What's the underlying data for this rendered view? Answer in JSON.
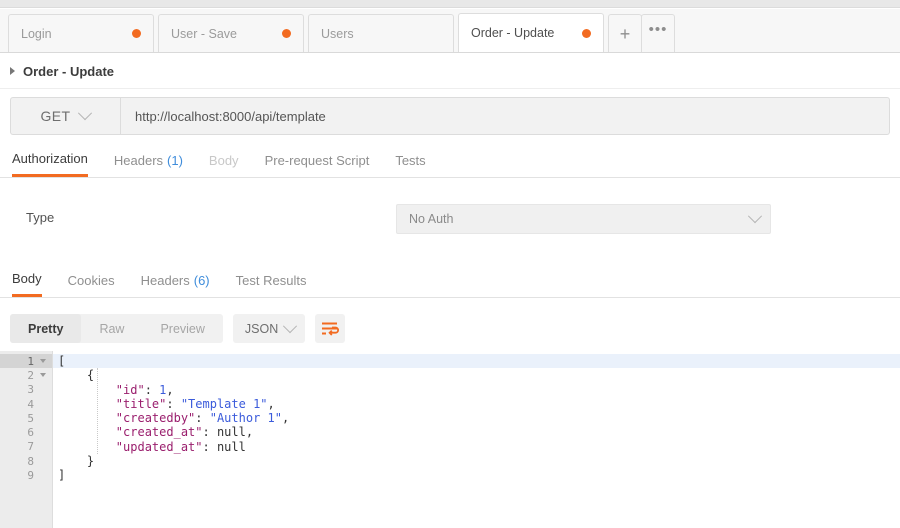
{
  "window": {
    "tabs": [
      {
        "label": "Login",
        "unsaved": true,
        "active": false
      },
      {
        "label": "User - Save",
        "unsaved": true,
        "active": false
      },
      {
        "label": "Users",
        "unsaved": false,
        "active": false
      },
      {
        "label": "Order - Update",
        "unsaved": true,
        "active": true
      }
    ],
    "new_tab_label": "+",
    "more_tabs_label": "•••"
  },
  "request": {
    "name": "Order - Update",
    "method": "GET",
    "url": "http://localhost:8000/api/template",
    "tabs": [
      {
        "label": "Authorization",
        "count": "",
        "state": "active"
      },
      {
        "label": "Headers",
        "count": "(1)",
        "state": "normal"
      },
      {
        "label": "Body",
        "count": "",
        "state": "disabled"
      },
      {
        "label": "Pre-request Script",
        "count": "",
        "state": "normal"
      },
      {
        "label": "Tests",
        "count": "",
        "state": "normal"
      }
    ]
  },
  "authorization": {
    "type_label": "Type",
    "selected_type": "No Auth"
  },
  "response": {
    "tabs": [
      {
        "label": "Body",
        "count": "",
        "state": "active"
      },
      {
        "label": "Cookies",
        "count": "",
        "state": "normal"
      },
      {
        "label": "Headers",
        "count": "(6)",
        "state": "normal"
      },
      {
        "label": "Test Results",
        "count": "",
        "state": "normal"
      }
    ],
    "view_modes": [
      {
        "label": "Pretty",
        "active": true
      },
      {
        "label": "Raw",
        "active": false
      },
      {
        "label": "Preview",
        "active": false
      }
    ],
    "format": "JSON",
    "wrap_icon": "word-wrap-icon",
    "accent_color": "#f26b21",
    "body_lines": [
      {
        "n": "1",
        "fold": true,
        "current": true,
        "indent": 0,
        "tokens": [
          {
            "t": "brace",
            "v": "["
          }
        ]
      },
      {
        "n": "2",
        "fold": true,
        "current": false,
        "indent": 1,
        "tokens": [
          {
            "t": "brace",
            "v": "{"
          }
        ]
      },
      {
        "n": "3",
        "fold": false,
        "current": false,
        "indent": 2,
        "tokens": [
          {
            "t": "key",
            "v": "\"id\""
          },
          {
            "t": "punc",
            "v": ": "
          },
          {
            "t": "num",
            "v": "1"
          },
          {
            "t": "punc",
            "v": ","
          }
        ]
      },
      {
        "n": "4",
        "fold": false,
        "current": false,
        "indent": 2,
        "tokens": [
          {
            "t": "key",
            "v": "\"title\""
          },
          {
            "t": "punc",
            "v": ": "
          },
          {
            "t": "str",
            "v": "\"Template 1\""
          },
          {
            "t": "punc",
            "v": ","
          }
        ]
      },
      {
        "n": "5",
        "fold": false,
        "current": false,
        "indent": 2,
        "tokens": [
          {
            "t": "key",
            "v": "\"createdby\""
          },
          {
            "t": "punc",
            "v": ": "
          },
          {
            "t": "str",
            "v": "\"Author 1\""
          },
          {
            "t": "punc",
            "v": ","
          }
        ]
      },
      {
        "n": "6",
        "fold": false,
        "current": false,
        "indent": 2,
        "tokens": [
          {
            "t": "key",
            "v": "\"created_at\""
          },
          {
            "t": "punc",
            "v": ": "
          },
          {
            "t": "null",
            "v": "null"
          },
          {
            "t": "punc",
            "v": ","
          }
        ]
      },
      {
        "n": "7",
        "fold": false,
        "current": false,
        "indent": 2,
        "tokens": [
          {
            "t": "key",
            "v": "\"updated_at\""
          },
          {
            "t": "punc",
            "v": ": "
          },
          {
            "t": "null",
            "v": "null"
          }
        ]
      },
      {
        "n": "8",
        "fold": false,
        "current": false,
        "indent": 1,
        "tokens": [
          {
            "t": "brace",
            "v": "}"
          }
        ]
      },
      {
        "n": "9",
        "fold": false,
        "current": false,
        "indent": 0,
        "tokens": [
          {
            "t": "brace",
            "v": "]"
          }
        ]
      }
    ]
  }
}
